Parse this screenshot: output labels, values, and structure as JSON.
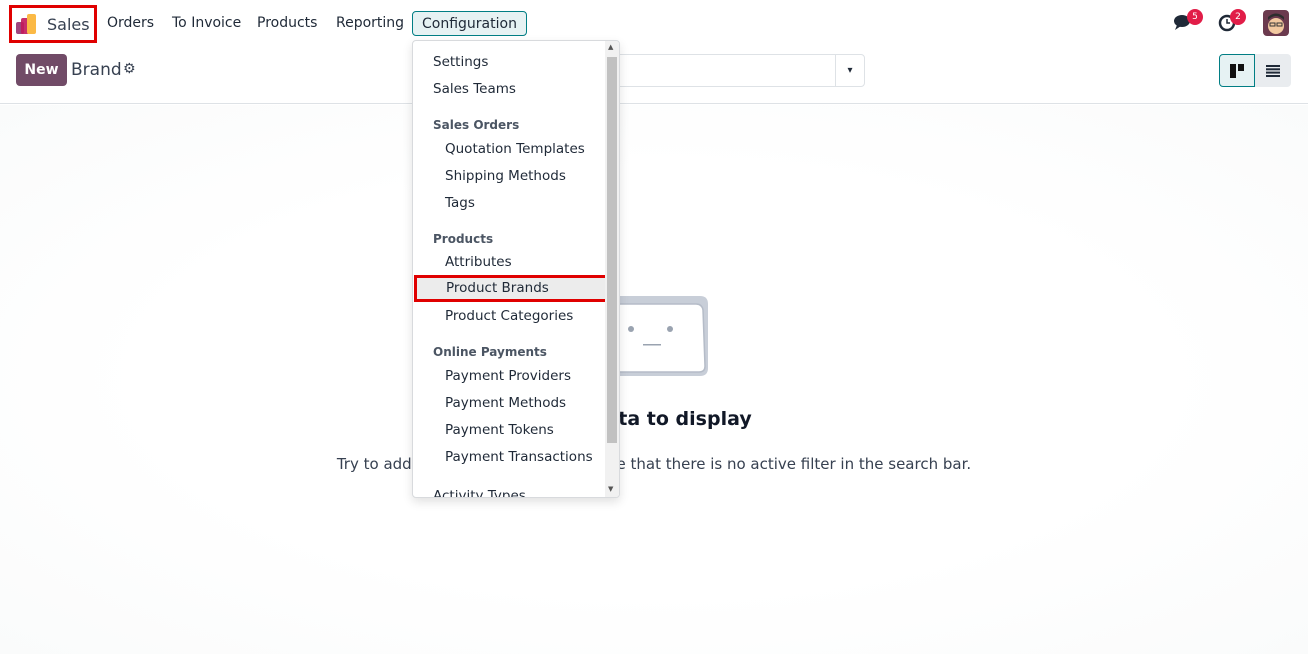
{
  "app": {
    "name": "Sales",
    "colors": {
      "accent": "#714b67",
      "active": "#017e84",
      "highlight": "#e00000"
    }
  },
  "nav": [
    "Orders",
    "To Invoice",
    "Products",
    "Reporting",
    "Configuration"
  ],
  "systray": {
    "messages_count": "5",
    "activities_count": "2",
    "messages_icon": "chat-icon",
    "activities_icon": "clock-icon"
  },
  "control": {
    "new_label": "New",
    "breadcrumb": "Brand",
    "gear_icon": "⚙",
    "dropdown_caret": "▾"
  },
  "empty": {
    "title": "No data to display",
    "text": "Try to add some records, or make sure that there is no active filter in the search bar."
  },
  "dropdown": {
    "items": [
      {
        "type": "item",
        "label": "Settings"
      },
      {
        "type": "item",
        "label": "Sales Teams"
      },
      {
        "type": "header",
        "label": "Sales Orders"
      },
      {
        "type": "sub",
        "label": "Quotation Templates"
      },
      {
        "type": "sub",
        "label": "Shipping Methods"
      },
      {
        "type": "sub",
        "label": "Tags"
      },
      {
        "type": "header",
        "label": "Products"
      },
      {
        "type": "sub",
        "label": "Attributes"
      },
      {
        "type": "sub",
        "label": "Product Brands",
        "highlighted": true
      },
      {
        "type": "sub",
        "label": "Product Categories"
      },
      {
        "type": "header",
        "label": "Online Payments"
      },
      {
        "type": "sub",
        "label": "Payment Providers"
      },
      {
        "type": "sub",
        "label": "Payment Methods"
      },
      {
        "type": "sub",
        "label": "Payment Tokens"
      },
      {
        "type": "sub",
        "label": "Payment Transactions"
      },
      {
        "type": "item",
        "label": "Activity Types"
      }
    ]
  }
}
